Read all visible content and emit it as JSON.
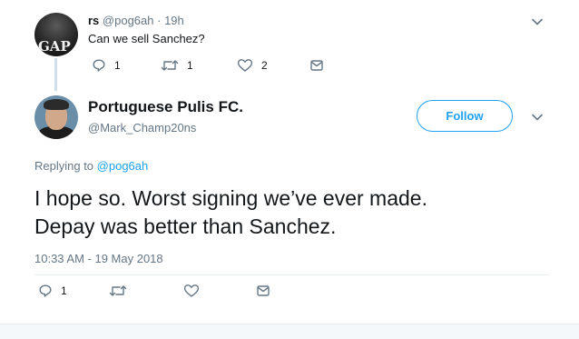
{
  "parent_tweet": {
    "display_name": "rs",
    "handle": "@pog6ah",
    "time": "· 19h",
    "text": "Can we sell Sanchez?",
    "reply_count": "1",
    "retweet_count": "1",
    "like_count": "2",
    "avatar_text": "GAP"
  },
  "main_tweet": {
    "display_name": "Portuguese Pulis FC.",
    "handle": "@Mark_Champ20ns",
    "follow_label": "Follow",
    "replying_prefix": "Replying to",
    "replying_to": "@pog6ah",
    "text_line1": "I hope so. Worst signing we’ve ever made.",
    "text_line2": "Depay was better than Sanchez.",
    "timestamp": "10:33 AM - 19 May 2018",
    "reply_count": "1"
  },
  "colors": {
    "accent": "#1da1f2",
    "muted": "#657786",
    "text": "#14171a",
    "thread_line": "#cfe0ec"
  },
  "icons": [
    "reply-icon",
    "retweet-icon",
    "like-icon",
    "message-icon",
    "chevron-down-icon"
  ]
}
